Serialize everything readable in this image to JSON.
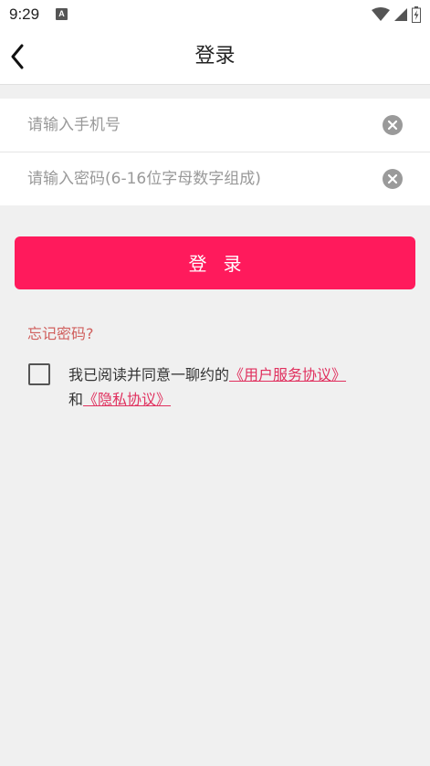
{
  "status_bar": {
    "time": "9:29",
    "notification_badge": "A"
  },
  "header": {
    "title": "登录",
    "back_icon": "chevron-left-icon"
  },
  "form": {
    "phone_placeholder": "请输入手机号",
    "phone_value": "",
    "password_placeholder": "请输入密码(6-16位字母数字组成)",
    "password_value": "",
    "clear_icon": "clear-circle-icon"
  },
  "login_button_label": "登录",
  "forgot_password": "忘记密码?",
  "agreement": {
    "checked": false,
    "prefix": "我已阅读并同意一聊约的",
    "user_agreement": "《用户服务协议》",
    "and": "和",
    "privacy_policy": "《隐私协议》"
  },
  "colors": {
    "accent": "#ff1a5c",
    "link": "#e0305e",
    "forgot": "#d0605e",
    "background": "#f0f0f0"
  }
}
